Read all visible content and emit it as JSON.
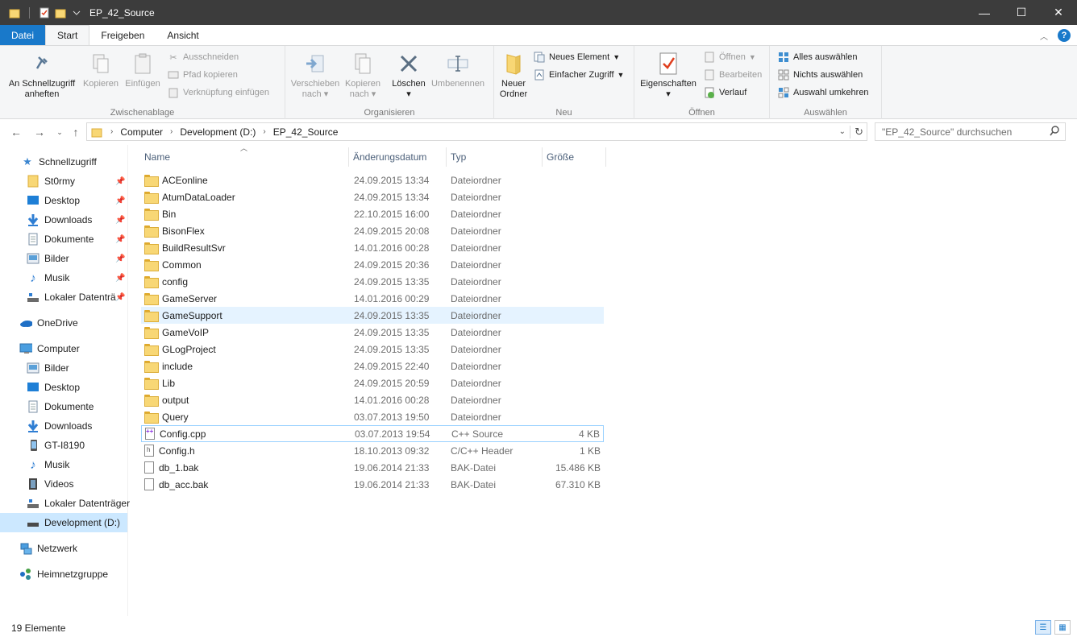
{
  "window": {
    "title": "EP_42_Source",
    "minimize": "—",
    "maximize": "☐",
    "close": "✕"
  },
  "tabs": [
    {
      "label": "Datei"
    },
    {
      "label": "Start"
    },
    {
      "label": "Freigeben"
    },
    {
      "label": "Ansicht"
    }
  ],
  "ribbon": {
    "clipboard": {
      "pin_label_1": "An Schnellzugriff",
      "pin_label_2": "anheften",
      "copy": "Kopieren",
      "paste": "Einfügen",
      "cut": "Ausschneiden",
      "copy_path": "Pfad kopieren",
      "paste_shortcut": "Verknüpfung einfügen",
      "group": "Zwischenablage"
    },
    "organize": {
      "move_1": "Verschieben",
      "move_2": "nach",
      "copyto_1": "Kopieren",
      "copyto_2": "nach",
      "delete": "Löschen",
      "rename": "Umbenennen",
      "group": "Organisieren"
    },
    "new": {
      "new_folder_1": "Neuer",
      "new_folder_2": "Ordner",
      "new_item": "Neues Element",
      "easy_access": "Einfacher Zugriff",
      "group": "Neu"
    },
    "open": {
      "properties": "Eigenschaften",
      "open": "Öffnen",
      "edit": "Bearbeiten",
      "history": "Verlauf",
      "group": "Öffnen"
    },
    "select": {
      "select_all": "Alles auswählen",
      "select_none": "Nichts auswählen",
      "invert": "Auswahl umkehren",
      "group": "Auswählen"
    }
  },
  "address": {
    "crumbs": [
      "Computer",
      "Development (D:)",
      "EP_42_Source"
    ],
    "search_placeholder": "\"EP_42_Source\" durchsuchen"
  },
  "nav": {
    "quick_access": "Schnellzugriff",
    "quick_items": [
      "St0rmy",
      "Desktop",
      "Downloads",
      "Dokumente",
      "Bilder",
      "Musik",
      "Lokaler Datenträ"
    ],
    "onedrive": "OneDrive",
    "computer": "Computer",
    "computer_items": [
      "Bilder",
      "Desktop",
      "Dokumente",
      "Downloads",
      "GT-I8190",
      "Musik",
      "Videos",
      "Lokaler Datenträger",
      "Development (D:)"
    ],
    "network": "Netzwerk",
    "homegroup": "Heimnetzgruppe"
  },
  "columns": {
    "name": "Name",
    "date": "Änderungsdatum",
    "type": "Typ",
    "size": "Größe"
  },
  "files": [
    {
      "name": "ACEonline",
      "date": "24.09.2015 13:34",
      "type": "Dateiordner",
      "size": ""
    },
    {
      "name": "AtumDataLoader",
      "date": "24.09.2015 13:34",
      "type": "Dateiordner",
      "size": ""
    },
    {
      "name": "Bin",
      "date": "22.10.2015 16:00",
      "type": "Dateiordner",
      "size": ""
    },
    {
      "name": "BisonFlex",
      "date": "24.09.2015 20:08",
      "type": "Dateiordner",
      "size": ""
    },
    {
      "name": "BuildResultSvr",
      "date": "14.01.2016 00:28",
      "type": "Dateiordner",
      "size": ""
    },
    {
      "name": "Common",
      "date": "24.09.2015 20:36",
      "type": "Dateiordner",
      "size": ""
    },
    {
      "name": "config",
      "date": "24.09.2015 13:35",
      "type": "Dateiordner",
      "size": ""
    },
    {
      "name": "GameServer",
      "date": "14.01.2016 00:29",
      "type": "Dateiordner",
      "size": ""
    },
    {
      "name": "GameSupport",
      "date": "24.09.2015 13:35",
      "type": "Dateiordner",
      "size": ""
    },
    {
      "name": "GameVoIP",
      "date": "24.09.2015 13:35",
      "type": "Dateiordner",
      "size": ""
    },
    {
      "name": "GLogProject",
      "date": "24.09.2015 13:35",
      "type": "Dateiordner",
      "size": ""
    },
    {
      "name": "include",
      "date": "24.09.2015 22:40",
      "type": "Dateiordner",
      "size": ""
    },
    {
      "name": "Lib",
      "date": "24.09.2015 20:59",
      "type": "Dateiordner",
      "size": ""
    },
    {
      "name": "output",
      "date": "14.01.2016 00:28",
      "type": "Dateiordner",
      "size": ""
    },
    {
      "name": "Query",
      "date": "03.07.2013 19:50",
      "type": "Dateiordner",
      "size": ""
    },
    {
      "name": "Config.cpp",
      "date": "03.07.2013 19:54",
      "type": "C++ Source",
      "size": "4 KB"
    },
    {
      "name": "Config.h",
      "date": "18.10.2013 09:32",
      "type": "C/C++ Header",
      "size": "1 KB"
    },
    {
      "name": "db_1.bak",
      "date": "19.06.2014 21:33",
      "type": "BAK-Datei",
      "size": "15.486 KB"
    },
    {
      "name": "db_acc.bak",
      "date": "19.06.2014 21:33",
      "type": "BAK-Datei",
      "size": "67.310 KB"
    }
  ],
  "status": {
    "count": "19 Elemente"
  },
  "colors": {
    "accent": "#1979ca",
    "titlebar": "#3c3c3c",
    "selection": "#cce8ff",
    "hover": "#e5f3ff"
  }
}
